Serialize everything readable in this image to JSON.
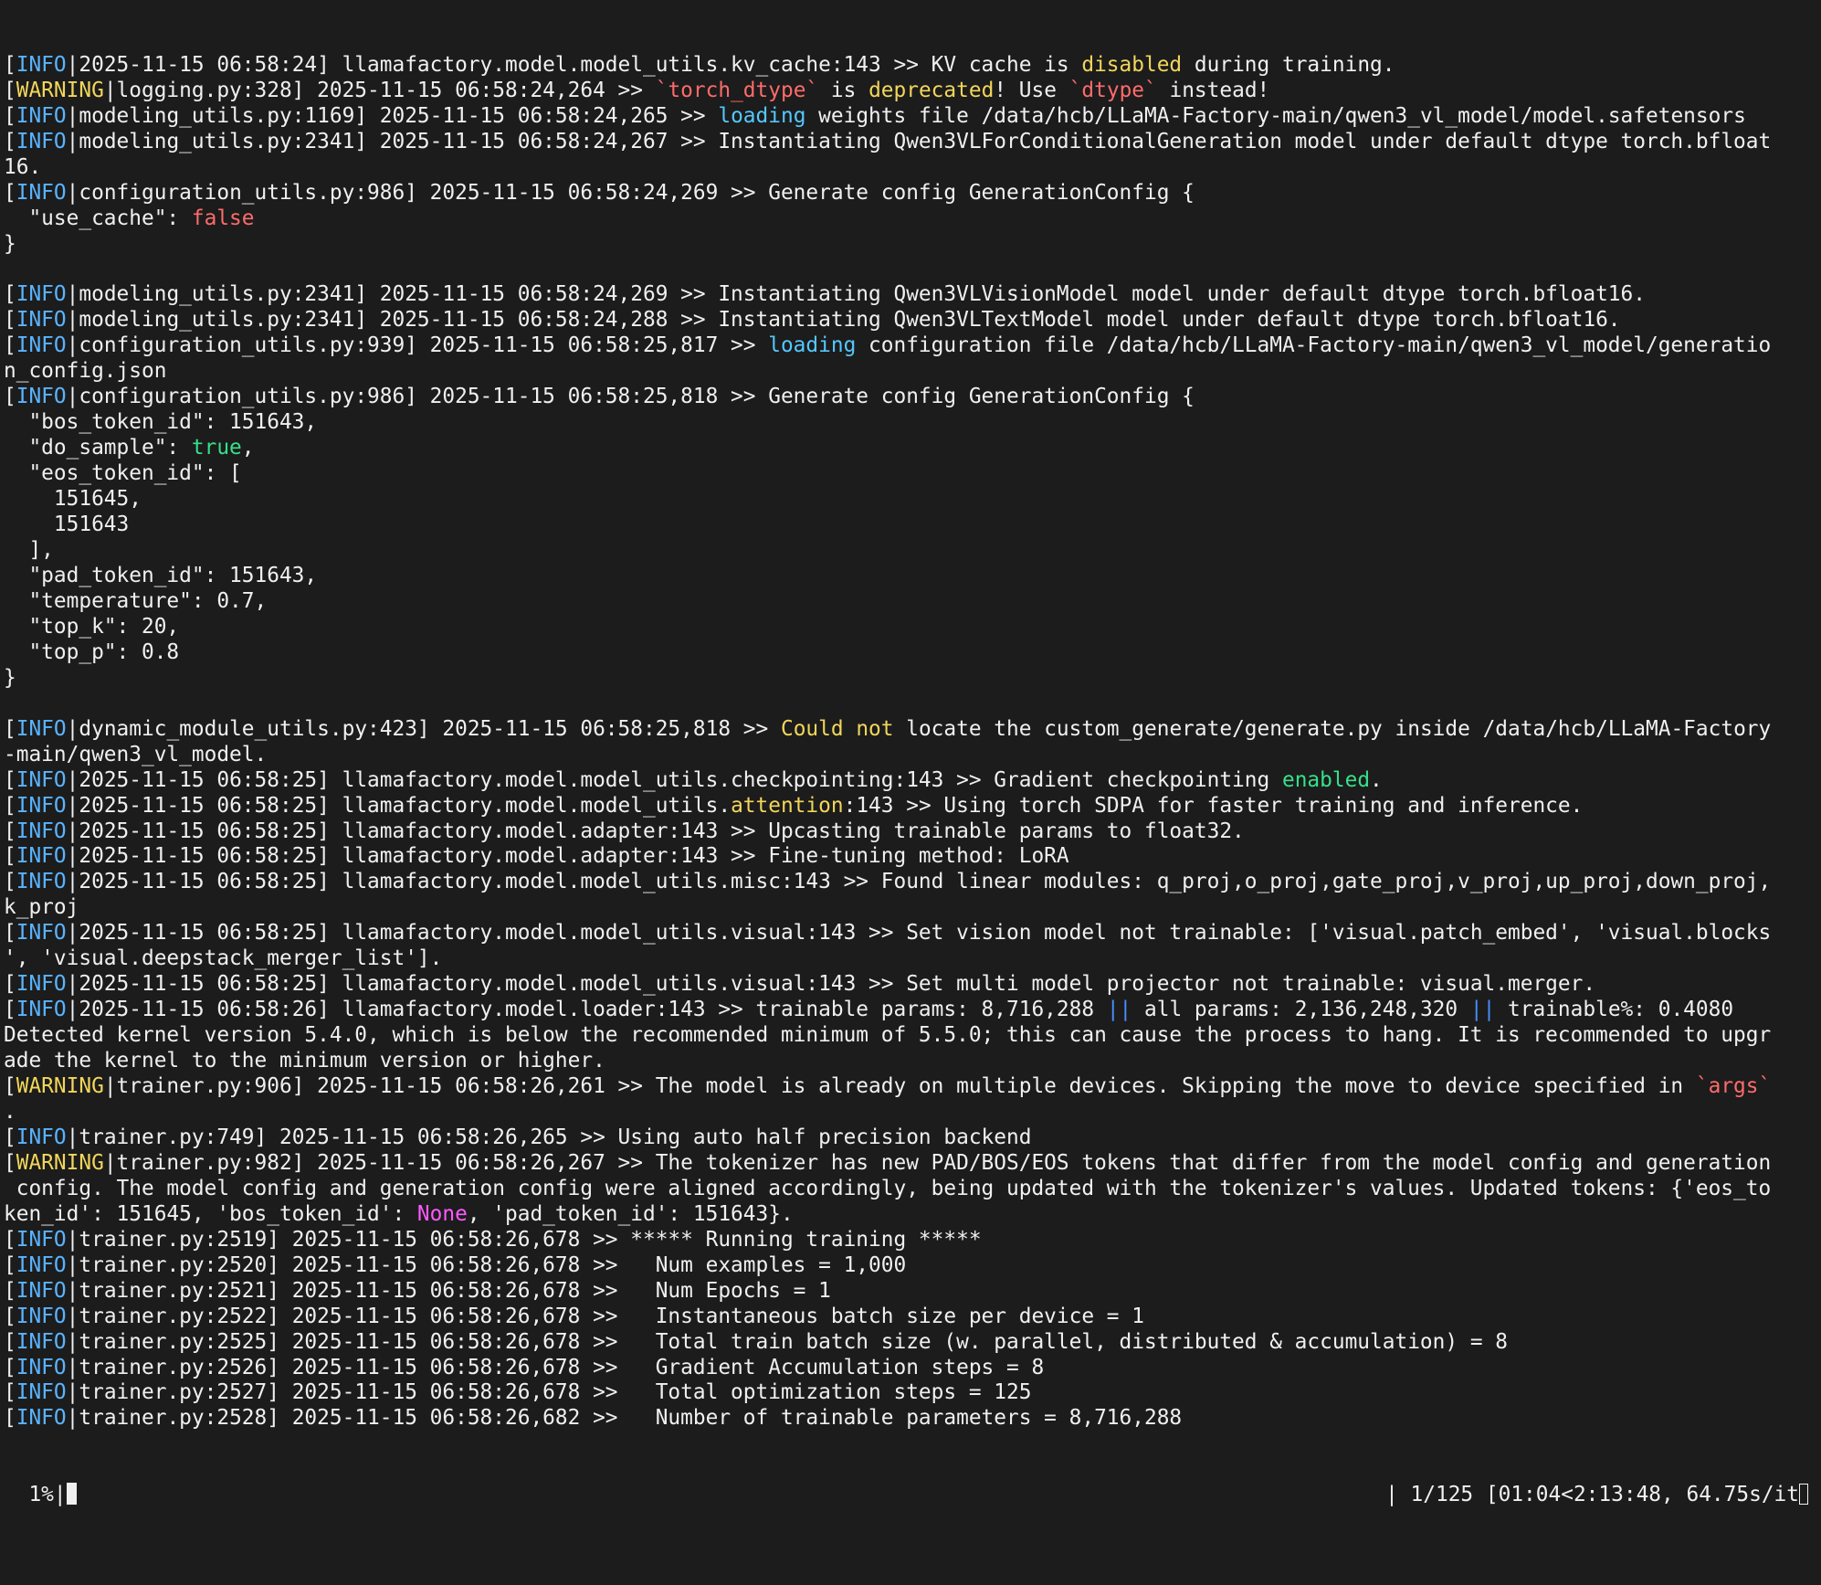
{
  "terminal": {
    "lines": [
      [
        [
          "[",
          ""
        ],
        [
          "INFO",
          "info"
        ],
        [
          "|2025-11-15 06:58:24] llamafactory.model.model_utils.kv_cache:143 >> KV cache is ",
          ""
        ],
        [
          "disabled",
          "yellow"
        ],
        [
          " during training.",
          ""
        ]
      ],
      [
        [
          "[",
          ""
        ],
        [
          "WARNING",
          "warn"
        ],
        [
          "|logging.py:328] 2025-11-15 06:58:24,264 >> ",
          ""
        ],
        [
          "`torch_dtype`",
          "red"
        ],
        [
          " is ",
          ""
        ],
        [
          "deprecated",
          "yellow"
        ],
        [
          "! Use ",
          ""
        ],
        [
          "`dtype`",
          "red"
        ],
        [
          " instead!",
          ""
        ]
      ],
      [
        [
          "[",
          ""
        ],
        [
          "INFO",
          "info"
        ],
        [
          "|modeling_utils.py:1169] 2025-11-15 06:58:24,265 >> ",
          ""
        ],
        [
          "loading",
          "cyan"
        ],
        [
          " weights file /data/hcb/LLaMA-Factory-main/qwen3_vl_model/model.safetensors",
          ""
        ]
      ],
      [
        [
          "[",
          ""
        ],
        [
          "INFO",
          "info"
        ],
        [
          "|modeling_utils.py:2341] 2025-11-15 06:58:24,267 >> Instantiating Qwen3VLForConditionalGeneration model under default dtype torch.bfloat",
          ""
        ]
      ],
      [
        [
          "16.",
          ""
        ]
      ],
      [
        [
          "[",
          ""
        ],
        [
          "INFO",
          "info"
        ],
        [
          "|configuration_utils.py:986] 2025-11-15 06:58:24,269 >> Generate config GenerationConfig {",
          ""
        ]
      ],
      [
        [
          "  \"use_cache\": ",
          ""
        ],
        [
          "false",
          "red"
        ]
      ],
      [
        [
          "}",
          ""
        ]
      ],
      [
        [
          "",
          ""
        ]
      ],
      [
        [
          "[",
          ""
        ],
        [
          "INFO",
          "info"
        ],
        [
          "|modeling_utils.py:2341] 2025-11-15 06:58:24,269 >> Instantiating Qwen3VLVisionModel model under default dtype torch.bfloat16.",
          ""
        ]
      ],
      [
        [
          "[",
          ""
        ],
        [
          "INFO",
          "info"
        ],
        [
          "|modeling_utils.py:2341] 2025-11-15 06:58:24,288 >> Instantiating Qwen3VLTextModel model under default dtype torch.bfloat16.",
          ""
        ]
      ],
      [
        [
          "[",
          ""
        ],
        [
          "INFO",
          "info"
        ],
        [
          "|configuration_utils.py:939] 2025-11-15 06:58:25,817 >> ",
          ""
        ],
        [
          "loading",
          "cyan"
        ],
        [
          " configuration file /data/hcb/LLaMA-Factory-main/qwen3_vl_model/generatio",
          ""
        ]
      ],
      [
        [
          "n_config.json",
          ""
        ]
      ],
      [
        [
          "[",
          ""
        ],
        [
          "INFO",
          "info"
        ],
        [
          "|configuration_utils.py:986] 2025-11-15 06:58:25,818 >> Generate config GenerationConfig {",
          ""
        ]
      ],
      [
        [
          "  \"bos_token_id\": 151643,",
          ""
        ]
      ],
      [
        [
          "  \"do_sample\": ",
          ""
        ],
        [
          "true",
          "green"
        ],
        [
          ",",
          ""
        ]
      ],
      [
        [
          "  \"eos_token_id\": [",
          ""
        ]
      ],
      [
        [
          "    151645,",
          ""
        ]
      ],
      [
        [
          "    151643",
          ""
        ]
      ],
      [
        [
          "  ],",
          ""
        ]
      ],
      [
        [
          "  \"pad_token_id\": 151643,",
          ""
        ]
      ],
      [
        [
          "  \"temperature\": 0.7,",
          ""
        ]
      ],
      [
        [
          "  \"top_k\": 20,",
          ""
        ]
      ],
      [
        [
          "  \"top_p\": 0.8",
          ""
        ]
      ],
      [
        [
          "}",
          ""
        ]
      ],
      [
        [
          "",
          ""
        ]
      ],
      [
        [
          "[",
          ""
        ],
        [
          "INFO",
          "info"
        ],
        [
          "|dynamic_module_utils.py:423] 2025-11-15 06:58:25,818 >> ",
          ""
        ],
        [
          "Could not",
          "yellow"
        ],
        [
          " locate the custom_generate/generate.py inside /data/hcb/LLaMA-Factory",
          ""
        ]
      ],
      [
        [
          "-main/qwen3_vl_model.",
          ""
        ]
      ],
      [
        [
          "[",
          ""
        ],
        [
          "INFO",
          "info"
        ],
        [
          "|2025-11-15 06:58:25] llamafactory.model.model_utils.checkpointing:143 >> Gradient checkpointing ",
          ""
        ],
        [
          "enabled",
          "green"
        ],
        [
          ".",
          ""
        ]
      ],
      [
        [
          "[",
          ""
        ],
        [
          "INFO",
          "info"
        ],
        [
          "|2025-11-15 06:58:25] llamafactory.model.model_utils.",
          ""
        ],
        [
          "attention",
          "yellow"
        ],
        [
          ":143 >> Using torch SDPA for faster training and inference.",
          ""
        ]
      ],
      [
        [
          "[",
          ""
        ],
        [
          "INFO",
          "info"
        ],
        [
          "|2025-11-15 06:58:25] llamafactory.model.adapter:143 >> Upcasting trainable params to float32.",
          ""
        ]
      ],
      [
        [
          "[",
          ""
        ],
        [
          "INFO",
          "info"
        ],
        [
          "|2025-11-15 06:58:25] llamafactory.model.adapter:143 >> Fine-tuning method: LoRA",
          ""
        ]
      ],
      [
        [
          "[",
          ""
        ],
        [
          "INFO",
          "info"
        ],
        [
          "|2025-11-15 06:58:25] llamafactory.model.model_utils.misc:143 >> Found linear modules: q_proj,o_proj,gate_proj,v_proj,up_proj,down_proj,",
          ""
        ]
      ],
      [
        [
          "k_proj",
          ""
        ]
      ],
      [
        [
          "[",
          ""
        ],
        [
          "INFO",
          "info"
        ],
        [
          "|2025-11-15 06:58:25] llamafactory.model.model_utils.visual:143 >> Set vision model not trainable: ['visual.patch_embed', 'visual.blocks",
          ""
        ]
      ],
      [
        [
          "', 'visual.deepstack_merger_list'].",
          ""
        ]
      ],
      [
        [
          "[",
          ""
        ],
        [
          "INFO",
          "info"
        ],
        [
          "|2025-11-15 06:58:25] llamafactory.model.model_utils.visual:143 >> Set multi model projector not trainable: visual.merger.",
          ""
        ]
      ],
      [
        [
          "[",
          ""
        ],
        [
          "INFO",
          "info"
        ],
        [
          "|2025-11-15 06:58:26] llamafactory.model.loader:143 >> trainable params: 8,716,288 ",
          ""
        ],
        [
          "||",
          "blue"
        ],
        [
          " all params: 2,136,248,320 ",
          ""
        ],
        [
          "||",
          "blue"
        ],
        [
          " trainable%: 0.4080",
          ""
        ]
      ],
      [
        [
          "Detected kernel version 5.4.0, which is below the recommended minimum of 5.5.0; this can cause the process to hang. It is recommended to upgr",
          ""
        ]
      ],
      [
        [
          "ade the kernel to the minimum version or higher.",
          ""
        ]
      ],
      [
        [
          "[",
          ""
        ],
        [
          "WARNING",
          "warn"
        ],
        [
          "|trainer.py:906] 2025-11-15 06:58:26,261 >> The model is already on multiple devices. Skipping the move to device specified in ",
          ""
        ],
        [
          "`args`",
          "red"
        ]
      ],
      [
        [
          ".",
          ""
        ]
      ],
      [
        [
          "[",
          ""
        ],
        [
          "INFO",
          "info"
        ],
        [
          "|trainer.py:749] 2025-11-15 06:58:26,265 >> Using auto half precision backend",
          ""
        ]
      ],
      [
        [
          "[",
          ""
        ],
        [
          "WARNING",
          "warn"
        ],
        [
          "|trainer.py:982] 2025-11-15 06:58:26,267 >> The tokenizer has new PAD/BOS/EOS tokens that differ from the model config and generation",
          ""
        ]
      ],
      [
        [
          " config. The model config and generation config were aligned accordingly, being updated with the tokenizer's values. Updated tokens: {'eos_to",
          ""
        ]
      ],
      [
        [
          "ken_id': 151645, 'bos_token_id': ",
          ""
        ],
        [
          "None",
          "pink"
        ],
        [
          ", 'pad_token_id': 151643}.",
          ""
        ]
      ],
      [
        [
          "[",
          ""
        ],
        [
          "INFO",
          "info"
        ],
        [
          "|trainer.py:2519] 2025-11-15 06:58:26,678 >> ***** Running training *****",
          ""
        ]
      ],
      [
        [
          "[",
          ""
        ],
        [
          "INFO",
          "info"
        ],
        [
          "|trainer.py:2520] 2025-11-15 06:58:26,678 >>   Num examples = 1,000",
          ""
        ]
      ],
      [
        [
          "[",
          ""
        ],
        [
          "INFO",
          "info"
        ],
        [
          "|trainer.py:2521] 2025-11-15 06:58:26,678 >>   Num Epochs = 1",
          ""
        ]
      ],
      [
        [
          "[",
          ""
        ],
        [
          "INFO",
          "info"
        ],
        [
          "|trainer.py:2522] 2025-11-15 06:58:26,678 >>   Instantaneous batch size per device = 1",
          ""
        ]
      ],
      [
        [
          "[",
          ""
        ],
        [
          "INFO",
          "info"
        ],
        [
          "|trainer.py:2525] 2025-11-15 06:58:26,678 >>   Total train batch size (w. parallel, distributed & accumulation) = 8",
          ""
        ]
      ],
      [
        [
          "[",
          ""
        ],
        [
          "INFO",
          "info"
        ],
        [
          "|trainer.py:2526] 2025-11-15 06:58:26,678 >>   Gradient Accumulation steps = 8",
          ""
        ]
      ],
      [
        [
          "[",
          ""
        ],
        [
          "INFO",
          "info"
        ],
        [
          "|trainer.py:2527] 2025-11-15 06:58:26,678 >>   Total optimization steps = 125",
          ""
        ]
      ],
      [
        [
          "[",
          ""
        ],
        [
          "INFO",
          "info"
        ],
        [
          "|trainer.py:2528] 2025-11-15 06:58:26,682 >>   Number of trainable parameters = 8,716,288",
          ""
        ]
      ]
    ],
    "progress": {
      "percent_text": "  1%|",
      "status_text": "| 1/125 [01:04<2:13:48, 64.75s/it",
      "progress_fraction": 0.008
    },
    "colors": {
      "background": "#1c1c1c",
      "foreground": "#f0f0f0",
      "info": "#5ab4ff",
      "warning": "#f2d65b",
      "red": "#ff6b6b",
      "green": "#37e08a",
      "cyan": "#54c8ff",
      "pink": "#ff59ff",
      "blue": "#4a8cff"
    }
  }
}
